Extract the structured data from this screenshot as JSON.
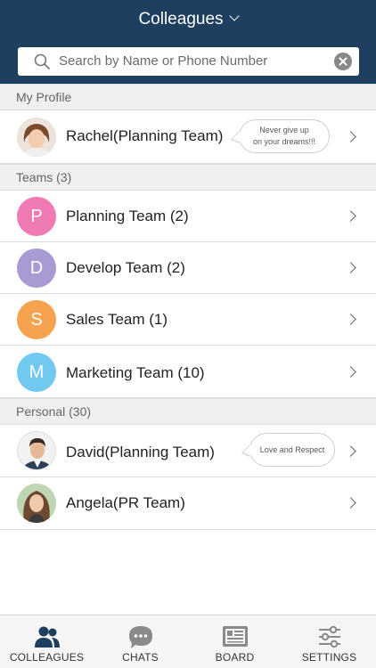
{
  "header": {
    "title": "Colleagues"
  },
  "search": {
    "placeholder": "Search by Name or Phone Number"
  },
  "sections": {
    "profile": "My Profile",
    "teams": "Teams (3)",
    "personal": "Personal (30)"
  },
  "profile": {
    "name": "Rachel(Planning Team)",
    "status": [
      "Never give up",
      "on your dreams!!!"
    ]
  },
  "teams": [
    {
      "initial": "P",
      "name": "Planning Team (2)",
      "color": "#f07bb4"
    },
    {
      "initial": "D",
      "name": "Develop Team (2)",
      "color": "#a99ad4"
    },
    {
      "initial": "S",
      "name": "Sales Team (1)",
      "color": "#f7a24f"
    },
    {
      "initial": "M",
      "name": "Marketing Team (10)",
      "color": "#72c9ef"
    }
  ],
  "personal": [
    {
      "name": "David(Planning Team)",
      "status": "Love and Respect"
    },
    {
      "name": "Angela(PR Team)"
    }
  ],
  "tabs": [
    {
      "label": "COLLEAGUES",
      "icon": "colleagues-icon",
      "active": true
    },
    {
      "label": "CHATS",
      "icon": "chat-bubble-icon"
    },
    {
      "label": "BOARD",
      "icon": "board-icon"
    },
    {
      "label": "SETTINGS",
      "icon": "sliders-icon"
    }
  ],
  "colors": {
    "header": "#1e3f5f",
    "active_tab": "#1e3f5f",
    "inactive_tab": "#8a8a8a"
  }
}
